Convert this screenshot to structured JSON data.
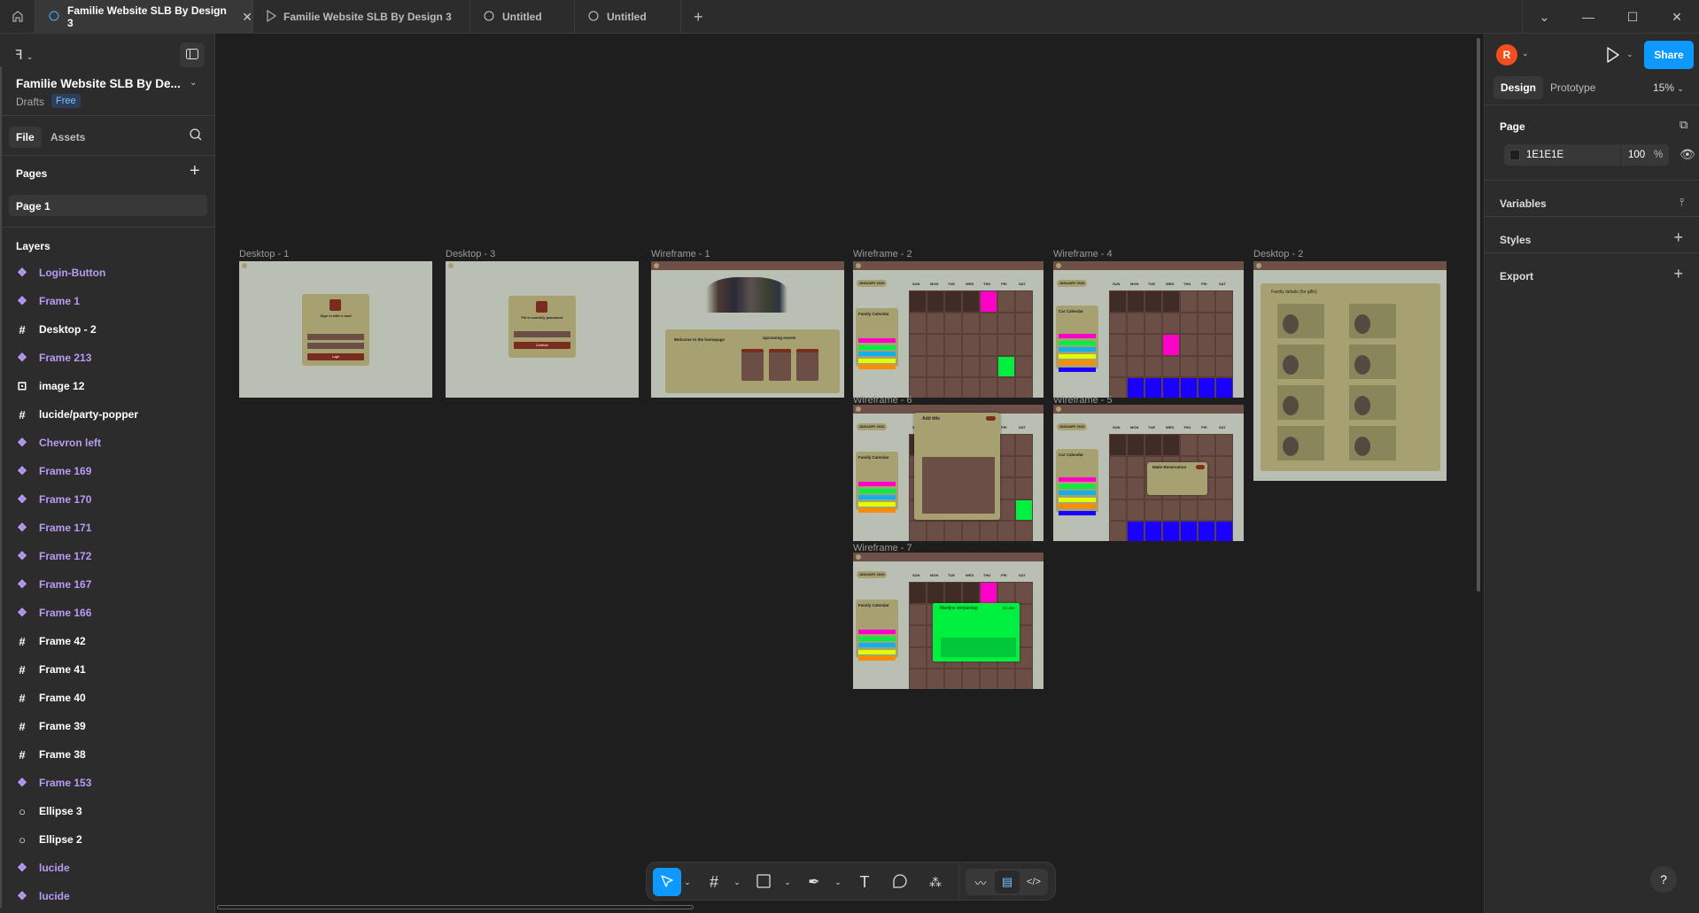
{
  "tabs": [
    {
      "label": "Familie Website SLB By Design 3",
      "icon": "figma-file-icon",
      "active": true
    },
    {
      "label": "Familie Website SLB By Design 3",
      "icon": "play-icon",
      "active": false
    },
    {
      "label": "Untitled",
      "icon": "figma-file-icon",
      "active": false
    },
    {
      "label": "Untitled",
      "icon": "figma-file-icon",
      "active": false
    }
  ],
  "file": {
    "name": "Familie Website SLB By De...",
    "location": "Drafts",
    "plan_badge": "Free"
  },
  "panel_tabs": {
    "file": "File",
    "assets": "Assets"
  },
  "pages": {
    "title": "Pages",
    "items": [
      "Page 1"
    ]
  },
  "layers": {
    "title": "Layers",
    "items": [
      {
        "name": "Login-Button",
        "type": "component"
      },
      {
        "name": "Frame 1",
        "type": "component"
      },
      {
        "name": "Desktop - 2",
        "type": "frame"
      },
      {
        "name": "Frame 213",
        "type": "component"
      },
      {
        "name": "image 12",
        "type": "image"
      },
      {
        "name": "lucide/party-popper",
        "type": "frame"
      },
      {
        "name": "Chevron left",
        "type": "component"
      },
      {
        "name": "Frame 169",
        "type": "component"
      },
      {
        "name": "Frame 170",
        "type": "component"
      },
      {
        "name": "Frame 171",
        "type": "component"
      },
      {
        "name": "Frame 172",
        "type": "component"
      },
      {
        "name": "Frame 167",
        "type": "component"
      },
      {
        "name": "Frame 166",
        "type": "component"
      },
      {
        "name": "Frame 42",
        "type": "frame"
      },
      {
        "name": "Frame 41",
        "type": "frame"
      },
      {
        "name": "Frame 40",
        "type": "frame"
      },
      {
        "name": "Frame 39",
        "type": "frame"
      },
      {
        "name": "Frame 38",
        "type": "frame"
      },
      {
        "name": "Frame 153",
        "type": "component"
      },
      {
        "name": "Ellipse 3",
        "type": "ellipse"
      },
      {
        "name": "Ellipse 2",
        "type": "ellipse"
      },
      {
        "name": "lucide",
        "type": "component"
      },
      {
        "name": "lucide",
        "type": "component"
      }
    ]
  },
  "right_panel": {
    "avatar_initial": "R",
    "avatar_color": "#f24e1e",
    "share": "Share",
    "share_color": "#0d99ff",
    "tabs": {
      "design": "Design",
      "prototype": "Prototype"
    },
    "zoom": "15%",
    "page_title": "Page",
    "bg_color_hex": "1E1E1E",
    "bg_opacity": "100",
    "percent": "%",
    "variables": "Variables",
    "styles": "Styles",
    "export": "Export"
  },
  "canvas": {
    "frames": {
      "desktop1": {
        "label": "Desktop - 1",
        "title": "Sign in with e-mail",
        "button": "Login"
      },
      "desktop3": {
        "label": "Desktop - 3",
        "title": "Fill in monthly password",
        "button": "Continue"
      },
      "wireframe1": {
        "label": "Wireframe - 1",
        "welcome": "Welcome to the homepage",
        "events": "Upcoming events"
      },
      "wireframe2": {
        "label": "Wireframe - 2",
        "sidebar": "Family Calendar"
      },
      "wireframe4": {
        "label": "Wireframe - 4",
        "sidebar": "Car Calendar"
      },
      "desktop2": {
        "label": "Desktop - 2",
        "title": "Family details (for gifts)"
      },
      "wireframe6": {
        "label": "Wireframe - 6",
        "sidebar": "Family Calendar",
        "dialog": "Add title"
      },
      "wireframe5": {
        "label": "Wireframe - 5",
        "sidebar": "Car Calendar",
        "dialog": "Make Reservation"
      },
      "wireframe7": {
        "label": "Wireframe - 7",
        "sidebar": "Family Calendar",
        "dialog": "Martijns verjaardag",
        "dialog_date": "23 Jan"
      }
    },
    "month": "JANUARY 2026",
    "days": [
      "SUN",
      "MON",
      "TUE",
      "WED",
      "THU",
      "FRI",
      "SAT"
    ],
    "colors": {
      "frame_bg": "#b9bfb2",
      "header": "#6e5048",
      "card": "#a7a070",
      "cell": "#6b4f47",
      "cell_dark": "#3f2c27",
      "magenta": "#ff00c8",
      "green": "#00f040",
      "cyan": "#10b0f0",
      "yellow": "#e0ff00",
      "orange": "#ff8c00",
      "blue": "#1a00ff"
    }
  },
  "toolbar": {
    "tools": [
      "move-icon",
      "frame-icon",
      "rectangle-icon",
      "pen-icon",
      "text-icon",
      "comment-icon",
      "actions-icon"
    ],
    "modes": [
      "draw-icon",
      "design-mode-icon",
      "dev-mode-icon"
    ],
    "accent": "#0d99ff"
  },
  "help": "?"
}
